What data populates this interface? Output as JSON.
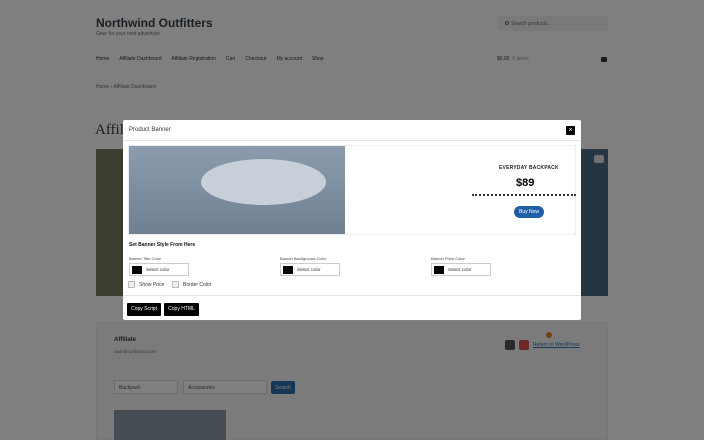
{
  "site": {
    "title": "Northwind Outfitters",
    "tagline": "Gear for your next adventure",
    "search_placeholder": "Search products…",
    "nav": [
      "Home",
      "Affiliate Dashboard",
      "Affiliate Registration",
      "Cart",
      "Checkout",
      "My account",
      "Shop"
    ],
    "cart_total": "$0.00",
    "cart_items": "0 items",
    "breadcrumb": "Home › Affiliate Dashboard",
    "page_heading": "Affili"
  },
  "profile": {
    "name": "Affiliate",
    "email": "user@northwind.com",
    "logout_label": "Return to WordPress",
    "filter_one": "Backpack",
    "filter_two": "Accessories",
    "filter_button": "Search"
  },
  "modal": {
    "title": "Product Banner",
    "close_glyph": "×",
    "product_name": "EVERYDAY BACKPACK",
    "product_price": "$89",
    "buy_button": "Buy Now",
    "style_heading": "Set Banner Style From Here",
    "title_color_label": "Banner Title Color",
    "background_color_label": "Banner Background Color",
    "price_color_label": "Banner Price Color",
    "select_color": "Select color",
    "show_price_label": "Show Price",
    "border_color_label": "Border Color",
    "copy_script": "Copy Script",
    "copy_html": "Copy HTML"
  },
  "colors": {
    "buy_button": "#1f5fa8",
    "swatch": "#000000",
    "accent": "#2c6eab"
  }
}
